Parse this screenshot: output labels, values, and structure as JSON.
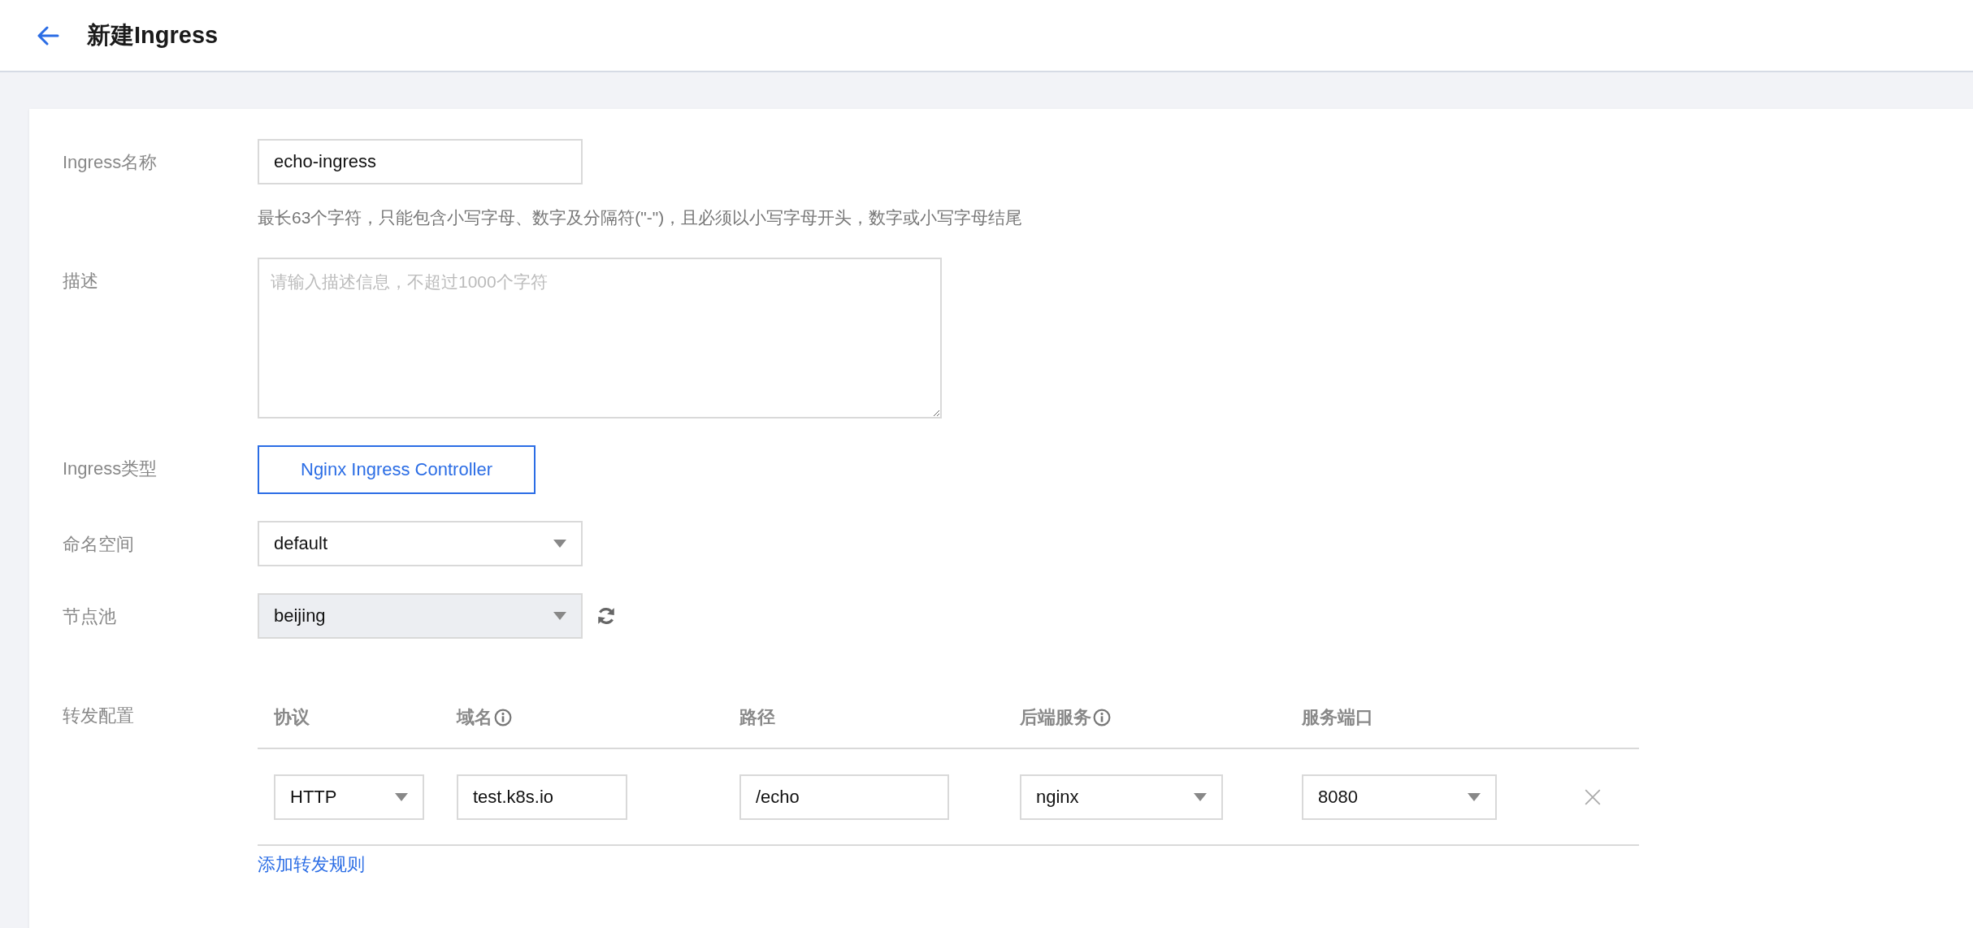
{
  "header": {
    "title": "新建Ingress"
  },
  "name_field": {
    "label": "Ingress名称",
    "value": "echo-ingress",
    "help": "最长63个字符，只能包含小写字母、数字及分隔符(\"-\")，且必须以小写字母开头，数字或小写字母结尾"
  },
  "description_field": {
    "label": "描述",
    "placeholder": "请输入描述信息，不超过1000个字符"
  },
  "type_field": {
    "label": "Ingress类型",
    "options": [
      {
        "label": "Nginx Ingress Controller",
        "selected": true
      }
    ]
  },
  "namespace_field": {
    "label": "命名空间",
    "value": "default",
    "disabled": false
  },
  "node_pool_field": {
    "label": "节点池",
    "value": "beijing",
    "disabled": true
  },
  "forwarding": {
    "label": "转发配置",
    "columns": [
      {
        "label": "协议",
        "info": false
      },
      {
        "label": "域名",
        "info": true
      },
      {
        "label": "路径",
        "info": false
      },
      {
        "label": "后端服务",
        "info": true
      },
      {
        "label": "服务端口",
        "info": false
      }
    ],
    "rules": [
      {
        "protocol": "HTTP",
        "domain": "test.k8s.io",
        "path": "/echo",
        "backend_service": "nginx",
        "service_port": "8080"
      }
    ],
    "add_link": "添加转发规则"
  }
}
